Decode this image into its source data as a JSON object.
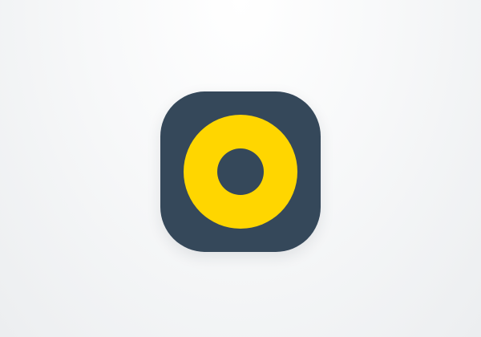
{
  "app_icon": {
    "icon": "ring-icon",
    "tile_color": "#35485a",
    "ring_color": "#ffd600",
    "inner_color": "#35485a"
  },
  "background": {
    "color_top": "#ffffff",
    "color_bottom": "#eceef0"
  }
}
